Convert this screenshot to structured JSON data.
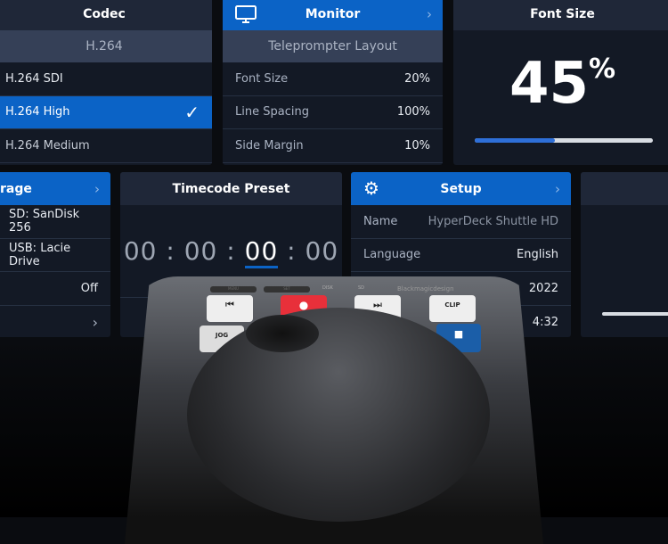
{
  "codec": {
    "title": "Codec",
    "current": "H.264",
    "items": [
      {
        "label": "H.264 SDI",
        "selected": false
      },
      {
        "label": "H.264 High",
        "selected": true
      },
      {
        "label": "H.264 Medium",
        "selected": false
      }
    ]
  },
  "monitor": {
    "title": "Monitor",
    "subtitle": "Teleprompter Layout",
    "rows": [
      {
        "label": "Font Size",
        "value": "20%"
      },
      {
        "label": "Line Spacing",
        "value": "100%"
      },
      {
        "label": "Side Margin",
        "value": "10%"
      }
    ]
  },
  "font_size": {
    "title": "Font Size",
    "value": "45",
    "unit": "%",
    "slider_percent": 45
  },
  "storage": {
    "title": "rage",
    "rows": [
      "SD: SanDisk 256",
      "USB: Lacie Drive",
      "Off"
    ]
  },
  "timecode": {
    "title": "Timecode Preset",
    "parts": [
      "00",
      "00",
      "00",
      "00"
    ],
    "separator": ":",
    "active_index": 2
  },
  "setup": {
    "title": "Setup",
    "rows": [
      {
        "label": "Name",
        "value": "HyperDeck Shuttle HD"
      },
      {
        "label": "Language",
        "value": "English"
      },
      {
        "label": "",
        "value": "2022"
      },
      {
        "label": "",
        "value": "4:32"
      }
    ]
  },
  "device": {
    "buttons": {
      "menu": "MENU",
      "set": "SET",
      "clip": "CLIP",
      "jog": "JOG"
    },
    "leds": [
      "DISK",
      "SD"
    ],
    "brand": "Blackmagicdesign"
  },
  "colors": {
    "accent": "#0b63c6",
    "record": "#e8303a",
    "stop": "#1b5ea8"
  }
}
